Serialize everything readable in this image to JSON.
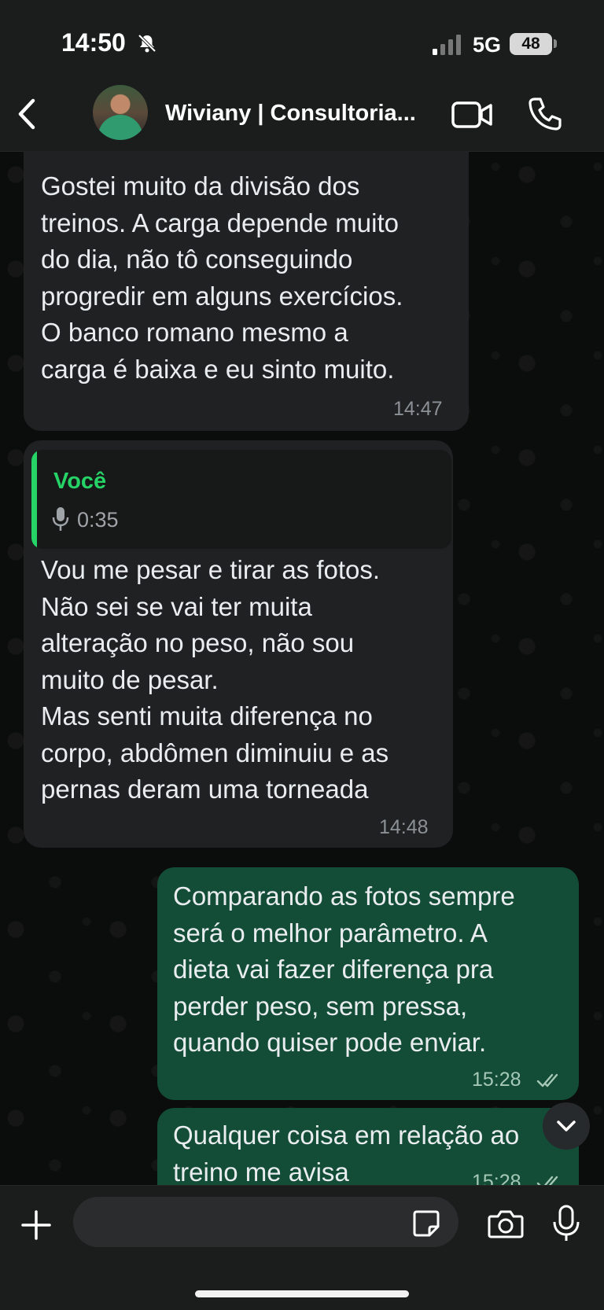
{
  "status_bar": {
    "time": "14:50",
    "network": "5G",
    "battery": "48"
  },
  "header": {
    "contact_name": "Wiviany | Consultoria..."
  },
  "messages": [
    {
      "direction": "incoming",
      "text": "Gostei muito da divisão dos\ntreinos. A carga depende muito\ndo dia, não tô conseguindo\nprogredir em alguns exercícios.\nO banco romano mesmo a\ncarga é baixa e eu sinto muito.",
      "time": "14:47"
    },
    {
      "direction": "incoming",
      "quote": {
        "author": "Você",
        "duration": "0:35"
      },
      "text": "Vou me pesar e tirar as fotos.\nNão sei se vai ter muita\nalteração no peso, não sou\nmuito de pesar.\nMas senti muita diferença no\ncorpo, abdômen diminuiu e as\npernas deram uma torneada",
      "time": "14:48"
    },
    {
      "direction": "outgoing",
      "text": "Comparando as fotos sempre\nserá o melhor parâmetro. A\ndieta vai fazer diferença pra\nperder peso, sem pressa,\nquando quiser pode enviar.",
      "time": "15:28"
    },
    {
      "direction": "outgoing",
      "text": "Qualquer coisa em relação ao\ntreino me avisa",
      "time": "15:28"
    }
  ],
  "composer": {
    "placeholder": ""
  },
  "colors": {
    "incoming_bubble": "#1f2122",
    "outgoing_bubble": "#144d37",
    "accent_green": "#25d366"
  },
  "icons": [
    "bell-off-icon",
    "signal-icon",
    "back-chevron-icon",
    "video-call-icon",
    "phone-icon",
    "microphone-icon",
    "double-check-icon",
    "chevron-down-icon",
    "plus-icon",
    "sticker-icon",
    "camera-icon"
  ]
}
